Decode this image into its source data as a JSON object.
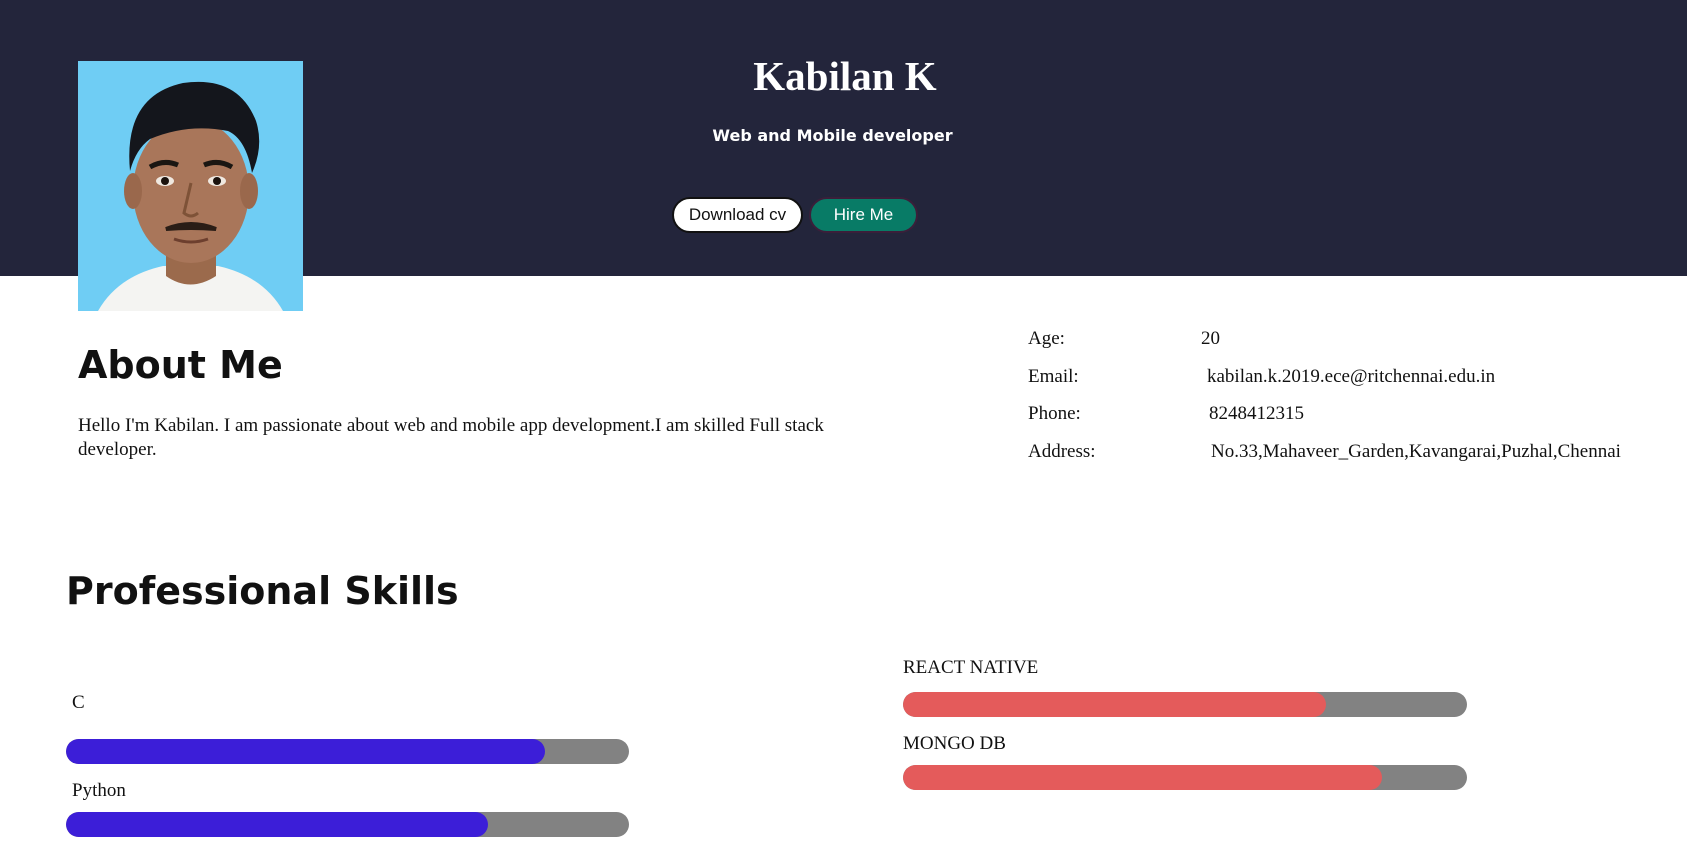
{
  "header": {
    "name": "Kabilan K",
    "subtitle": "Web and Mobile developer",
    "download_label": "Download cv",
    "hire_label": "Hire Me",
    "background_color": "#23253b"
  },
  "about": {
    "title": "About Me",
    "text": "Hello I'm Kabilan. I am passionate about web and mobile app development.I am skilled Full stack developer."
  },
  "info": [
    {
      "label": "Age:",
      "value": "20"
    },
    {
      "label": "Email:",
      "value": "kabilan.k.2019.ece@ritchennai.edu.in"
    },
    {
      "label": "Phone:",
      "value": "8248412315"
    },
    {
      "label": "Address:",
      "value": "No.33,Mahaveer_Garden,Kavangarai,Puzhal,Chennai"
    }
  ],
  "skills": {
    "title": "Professional Skills",
    "left": [
      {
        "label": "C",
        "level": 0.85,
        "color": "#3c1ed8"
      },
      {
        "label": "Python",
        "level": 0.75,
        "color": "#3c1ed8"
      }
    ],
    "right": [
      {
        "label": "REACT NATIVE",
        "level": 0.75,
        "color": "#e45b5b"
      },
      {
        "label": "MONGO DB",
        "level": 0.85,
        "color": "#e45b5b"
      }
    ],
    "track_color": "#828282"
  }
}
